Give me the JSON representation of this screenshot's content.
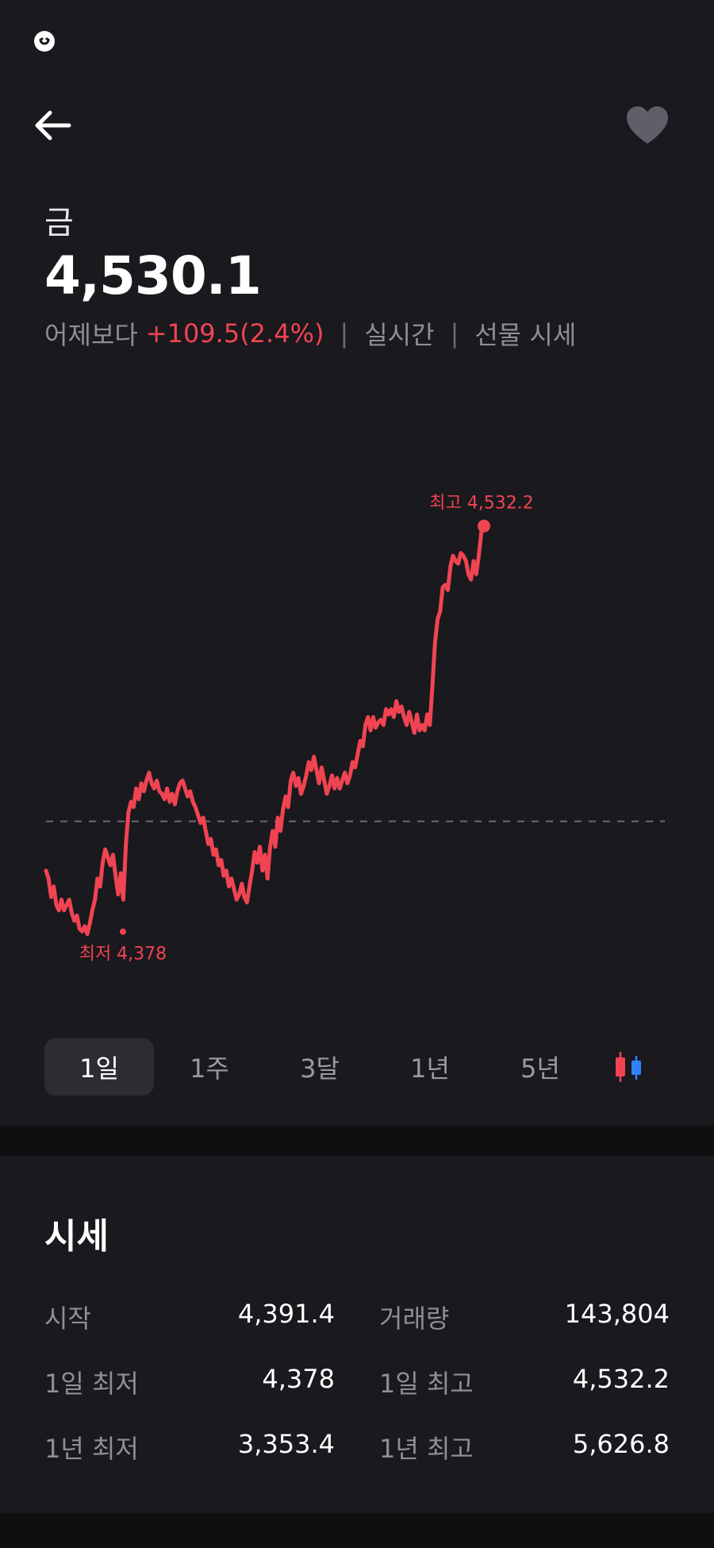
{
  "header": {
    "back_icon": "arrow-left-icon",
    "favorite_icon": "heart-icon"
  },
  "asset": {
    "name": "금",
    "price": "4,530.1",
    "compare_label": "어제보다",
    "change": "+109.5(2.4%)",
    "mode": "실시간",
    "source": "선물 시세"
  },
  "colors": {
    "up": "#f04452",
    "down": "#3182f6",
    "background": "#19191e"
  },
  "chart_data": {
    "type": "line",
    "series": [
      {
        "values": [
          4402,
          4399,
          4392,
          4396,
          4389,
          4387,
          4391,
          4387,
          4389,
          4391,
          4386,
          4383,
          4385,
          4380,
          4379,
          4381,
          4378,
          4382,
          4387,
          4391,
          4399,
          4396,
          4405,
          4410,
          4407,
          4404,
          4408,
          4400,
          4393,
          4401,
          4391,
          4412,
          4424,
          4428,
          4426,
          4433,
          4429,
          4435,
          4432,
          4436,
          4439,
          4435,
          4433,
          4436,
          4432,
          4431,
          4429,
          4433,
          4428,
          4431,
          4427,
          4432,
          4435,
          4436,
          4433,
          4430,
          4432,
          4428,
          4426,
          4423,
          4420,
          4422,
          4417,
          4412,
          4414,
          4408,
          4410,
          4404,
          4406,
          4400,
          4402,
          4396,
          4399,
          4395,
          4391,
          4393,
          4397,
          4392,
          4390,
          4396,
          4402,
          4409,
          4405,
          4411,
          4402,
          4408,
          4399,
          4411,
          4417,
          4411,
          4422,
          4417,
          4425,
          4430,
          4426,
          4436,
          4439,
          4434,
          4437,
          4431,
          4434,
          4438,
          4443,
          4440,
          4445,
          4440,
          4435,
          4441,
          4436,
          4431,
          4434,
          4438,
          4433,
          4437,
          4433,
          4436,
          4439,
          4435,
          4438,
          4443,
          4441,
          4446,
          4451,
          4449,
          4457,
          4460,
          4455,
          4460,
          4456,
          4458,
          4459,
          4457,
          4463,
          4461,
          4463,
          4460,
          4466,
          4462,
          4464,
          4460,
          4457,
          4462,
          4458,
          4454,
          4461,
          4455,
          4457,
          4455,
          4461,
          4457,
          4472,
          4488,
          4497,
          4500,
          4509,
          4510,
          4508,
          4517,
          4521,
          4519,
          4518,
          4522,
          4521,
          4519,
          4514,
          4512,
          4519,
          4514,
          4521,
          4530.1,
          4532.2
        ],
        "color": "#f04452"
      }
    ],
    "reference_line": {
      "value": 4420.6,
      "style": "dashed"
    },
    "annotations": [
      {
        "label": "최고 4,532.2",
        "value": 4532.2,
        "kind": "high"
      },
      {
        "label": "최저 4,378",
        "value": 4378,
        "kind": "low"
      }
    ],
    "xlabel": "",
    "ylabel": "",
    "ylim": [
      4365,
      4545
    ],
    "grid": false,
    "legend": "none"
  },
  "range_tabs": [
    {
      "label": "1일",
      "active": true
    },
    {
      "label": "1주",
      "active": false
    },
    {
      "label": "3달",
      "active": false
    },
    {
      "label": "1년",
      "active": false
    },
    {
      "label": "5년",
      "active": false
    }
  ],
  "chart_toggle_icon": "candlestick-icon",
  "stats": {
    "title": "시세",
    "rows": [
      {
        "label_left": "시작",
        "value_left": "4,391.4",
        "label_right": "거래량",
        "value_right": "143,804"
      },
      {
        "label_left": "1일 최저",
        "value_left": "4,378",
        "label_right": "1일 최고",
        "value_right": "4,532.2"
      },
      {
        "label_left": "1년 최저",
        "value_left": "3,353.4",
        "label_right": "1년 최고",
        "value_right": "5,626.8"
      }
    ]
  }
}
